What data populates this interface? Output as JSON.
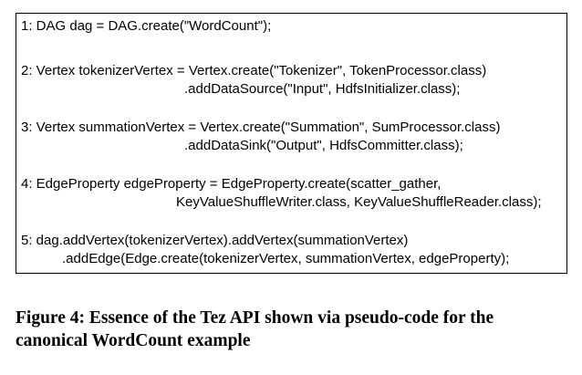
{
  "code": {
    "statements": [
      {
        "lines": [
          "1: DAG dag = DAG.create(\"WordCount\");"
        ]
      },
      {
        "lines": [
          "2: Vertex tokenizerVertex = Vertex.create(\"Tokenizer\", TokenProcessor.class)",
          ".addDataSource(\"Input\", HdfsInitializer.class);"
        ]
      },
      {
        "lines": [
          "3: Vertex summationVertex = Vertex.create(\"Summation\", SumProcessor.class)",
          ".addDataSink(\"Output\", HdfsCommitter.class);"
        ]
      },
      {
        "lines": [
          "4: EdgeProperty edgeProperty = EdgeProperty.create(scatter_gather,",
          "KeyValueShuffleWriter.class, KeyValueShuffleReader.class);"
        ]
      },
      {
        "lines": [
          "5: dag.addVertex(tokenizerVertex).addVertex(summationVertex)",
          ".addEdge(Edge.create(tokenizerVertex, summationVertex, edgeProperty);"
        ]
      }
    ]
  },
  "caption": {
    "line1": "Figure 4: Essence of the Tez API shown via pseudo-code for the",
    "line2": "canonical WordCount example"
  }
}
